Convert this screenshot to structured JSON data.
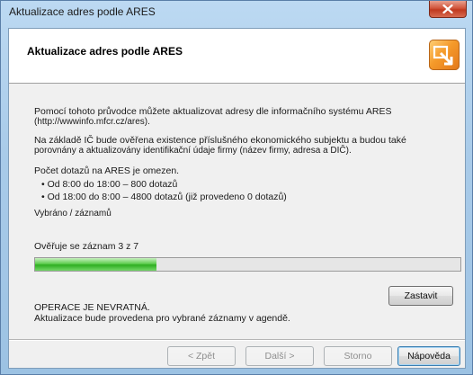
{
  "window": {
    "title": "Aktualizace adres podle ARES"
  },
  "header": {
    "title": "Aktualizace adres podle ARES",
    "icon": "wizard-arrow-icon"
  },
  "content": {
    "intro_line1": "Pomocí tohoto průvodce můžete aktualizovat adresy dle informačního systému ARES",
    "intro_line2": "(http://wwwinfo.mfcr.cz/ares).",
    "check_line1": "Na základě IČ bude ověřena existence příslušného ekonomického subjektu a budou také",
    "check_line2": "porovnány a aktualizovány identifikační údaje firmy (název firmy, adresa a DIČ).",
    "limit_title": "Počet dotazů na ARES je omezen.",
    "limit_day": "• Od 8:00 do 18:00 – 800 dotazů",
    "limit_night": "• Od 18:00 do 8:00 – 4800 dotazů (již provedeno 0 dotazů)",
    "selected": "Vybráno / záznamů",
    "progress_label": "Ověřuje se záznam 3 z 7",
    "progress_fraction": 0.2857,
    "warning_title": "OPERACE JE NEVRATNÁ.",
    "warning_text": "Aktualizace bude provedena pro vybrané záznamy v agendě."
  },
  "buttons": {
    "stop": "Zastavit",
    "back": "< Zpět",
    "next": "Další >",
    "cancel": "Storno",
    "help": "Nápověda"
  },
  "colors": {
    "progress": "#2fae22",
    "close_button": "#c0391f",
    "icon_accent": "#f59a2a"
  }
}
